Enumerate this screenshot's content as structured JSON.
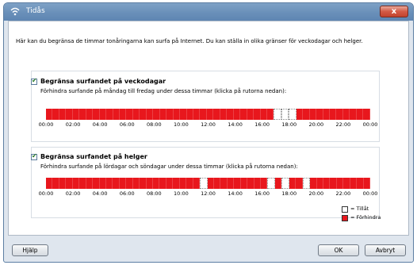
{
  "window": {
    "title": "Tidås",
    "close_glyph": "x"
  },
  "intro": "Här kan du begränsa de timmar tonåringarna kan surfa på Internet. Du kan ställa in olika gränser för veckodagar och helger.",
  "weekday": {
    "checked": true,
    "title": "Begränsa surfandet på veckodagar",
    "description": "Förhindra surfande på måndag till fredag under dessa timmar (klicka på rutorna nedan):",
    "allowed_halfhours": [
      34,
      35,
      36
    ]
  },
  "weekend": {
    "checked": true,
    "title": "Begränsa surfandet på helger",
    "description": "Förhindra surfande på lördagar och söndagar under dessa timmar (klicka på rutorna nedan):",
    "allowed_halfhours": [
      23,
      33,
      35,
      38
    ]
  },
  "time_labels": [
    "00:00",
    "02:00",
    "04:00",
    "06:00",
    "08:00",
    "10:00",
    "12:00",
    "14:00",
    "16:00",
    "18:00",
    "20:00",
    "22:00",
    "00:00"
  ],
  "legend": {
    "allow_label": "= Tillåt",
    "block_label": "= Förhindra",
    "block_color": "#e8171d"
  },
  "buttons": {
    "help": "Hjälp",
    "ok": "OK",
    "cancel": "Avbryt"
  }
}
